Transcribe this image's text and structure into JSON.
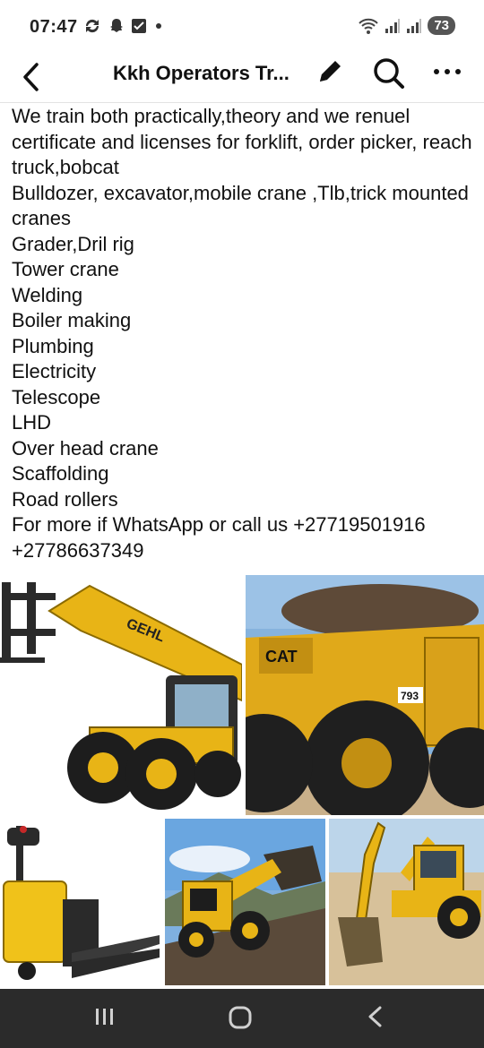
{
  "status": {
    "time": "07:47",
    "battery": "73",
    "notification_icons": [
      "sync-icon",
      "snapchat-icon",
      "check-icon",
      "dot-icon"
    ],
    "system_icons": [
      "wifi-icon",
      "signal-icon",
      "signal-icon"
    ]
  },
  "header": {
    "title": "Kkh Operators Tr...",
    "icons": [
      "back-arrow-icon",
      "edit-pencil-icon",
      "search-icon",
      "more-icon"
    ]
  },
  "post": {
    "lines": [
      "We train both practically,theory and we renuel certificate and licenses for forklift, order picker, reach truck,bobcat",
      "Bulldozer, excavator,mobile crane ,Tlb,trick mounted cranes",
      "Grader,Dril rig",
      "Tower crane",
      "Welding",
      "Boiler making",
      "Plumbing",
      "Electricity",
      "Telescope",
      "LHD",
      "Over head crane",
      "Scaffolding",
      "Road rollers",
      "For more if WhatsApp or call us +27719501916",
      "+27786637349"
    ]
  },
  "photos": {
    "telehandler_brand": "GEHL",
    "truck_brand": "CAT",
    "truck_number": "793"
  },
  "colors": {
    "machine_yellow": "#e8b416",
    "nav_bar": "#2b2b2b"
  },
  "nav": {
    "icons": [
      "recent-apps-icon",
      "home-icon",
      "back-icon"
    ]
  }
}
